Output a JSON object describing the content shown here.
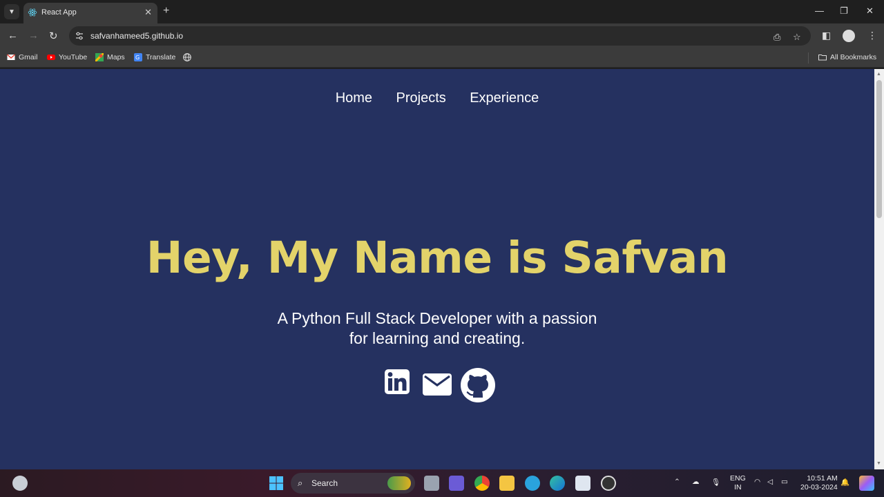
{
  "browser": {
    "tab_title": "React App",
    "url": "safvanhameed5.github.io",
    "bookmarks": [
      {
        "label": "Gmail",
        "icon": "gmail-icon"
      },
      {
        "label": "YouTube",
        "icon": "youtube-icon"
      },
      {
        "label": "Maps",
        "icon": "maps-icon"
      },
      {
        "label": "Translate",
        "icon": "translate-icon"
      }
    ],
    "all_bookmarks_label": "All Bookmarks"
  },
  "site": {
    "nav": [
      "Home",
      "Projects",
      "Experience"
    ],
    "hero_title": "Hey, My Name is Safvan",
    "subtitle_line1": "A Python Full Stack Developer with a passion",
    "subtitle_line2": "for learning and creating.",
    "social": [
      "linkedin-icon",
      "mail-icon",
      "github-icon"
    ],
    "colors": {
      "background": "#253160",
      "accent": "#e3d36a",
      "text": "#ffffff"
    }
  },
  "taskbar": {
    "search_label": "Search",
    "lang_top": "ENG",
    "lang_bottom": "IN",
    "time": "10:51 AM",
    "date": "20-03-2024"
  }
}
